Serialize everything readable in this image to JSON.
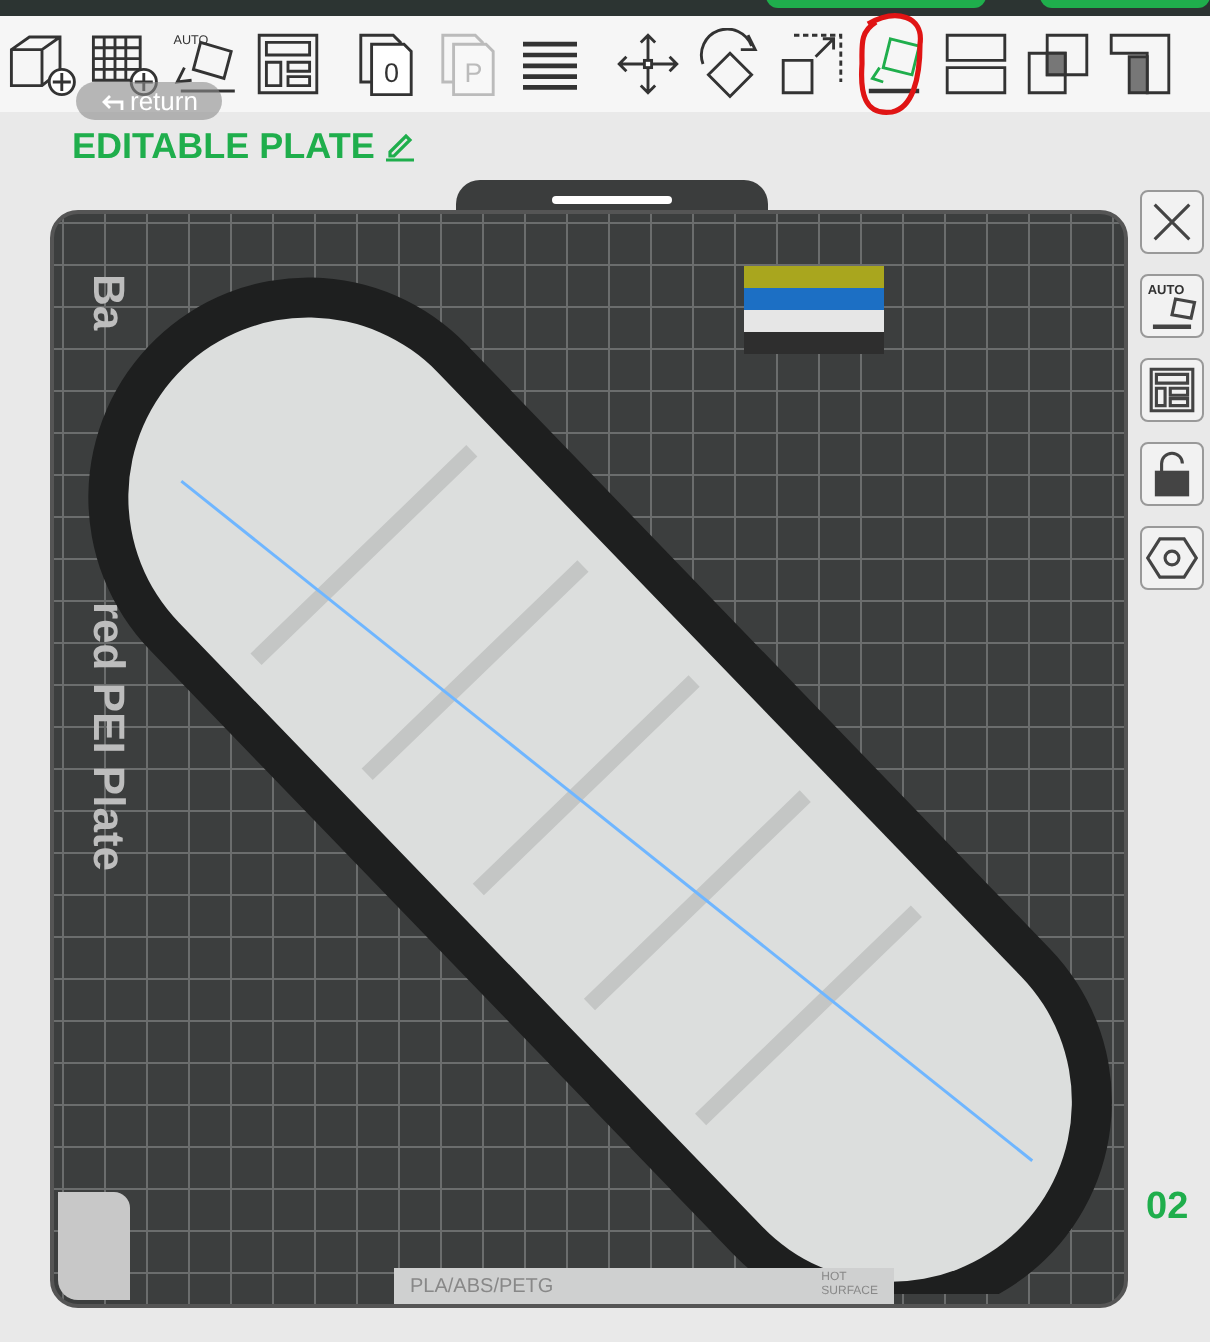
{
  "toolbar": {
    "items": [
      {
        "kind": "add-cube",
        "disabled": false,
        "selected": false
      },
      {
        "kind": "add-grid",
        "disabled": false,
        "selected": false
      },
      {
        "kind": "auto-orient",
        "badge": "AUTO",
        "disabled": false,
        "selected": false
      },
      {
        "kind": "arrange",
        "disabled": false,
        "selected": false
      },
      {
        "kind": "plate",
        "label": "0",
        "disabled": false,
        "selected": false
      },
      {
        "kind": "plate",
        "label": "P",
        "disabled": true,
        "selected": false
      },
      {
        "kind": "layers",
        "disabled": false,
        "selected": false
      },
      {
        "kind": "move",
        "disabled": false,
        "selected": false
      },
      {
        "kind": "rotate",
        "disabled": false,
        "selected": false
      },
      {
        "kind": "scale",
        "disabled": false,
        "selected": false
      },
      {
        "kind": "lay-on-face",
        "disabled": false,
        "selected": true
      },
      {
        "kind": "split",
        "disabled": false,
        "selected": false
      },
      {
        "kind": "boolean",
        "disabled": false,
        "selected": false
      },
      {
        "kind": "cut",
        "disabled": false,
        "selected": false
      }
    ]
  },
  "return_button": {
    "label": "return"
  },
  "plate": {
    "title": "EDITABLE PLATE",
    "name_parts": [
      "Ba",
      "red PEI Plate"
    ],
    "number": "02",
    "filament_colors": [
      {
        "color": "#a9a61e"
      },
      {
        "color": "#1c6fc4"
      },
      {
        "color": "#e6e6e6"
      },
      {
        "color": "#2e2e2e"
      }
    ],
    "label_strip": {
      "material": "PLA/ABS/PETG",
      "warning": [
        "HOT",
        "SURFACE"
      ]
    }
  },
  "side_tools": [
    {
      "kind": "close"
    },
    {
      "kind": "auto-orient",
      "badge": "AUTO"
    },
    {
      "kind": "arrange"
    },
    {
      "kind": "lock"
    },
    {
      "kind": "settings"
    }
  ]
}
